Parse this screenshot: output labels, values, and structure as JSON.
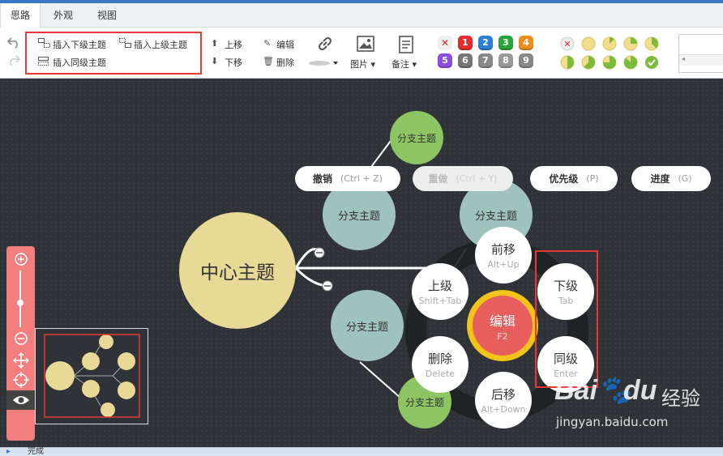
{
  "tabs": [
    {
      "label": "思路",
      "active": true
    },
    {
      "label": "外观",
      "active": false
    },
    {
      "label": "视图",
      "active": false
    }
  ],
  "toolbar": {
    "insert_child": "插入下级主题",
    "insert_parent": "插入上级主题",
    "insert_sibling": "插入同级主题",
    "move_up": "上移",
    "move_down": "下移",
    "edit": "编辑",
    "delete": "删除",
    "image": "图片",
    "note": "备注",
    "priorities": [
      "1",
      "2",
      "3",
      "4",
      "5",
      "6",
      "7",
      "8",
      "9"
    ],
    "priority_colors": [
      "#e52b2b",
      "#2a7fd6",
      "#2aa43a",
      "#f08c1a",
      "#8a4ee0",
      "#777777",
      "#888888",
      "#999999",
      "#888888"
    ]
  },
  "mindmap": {
    "central": "中心主题",
    "branches": [
      "分支主题",
      "分支主题",
      "分支主题",
      "分支主题",
      "分支主题"
    ]
  },
  "context_pills": [
    {
      "label": "撤销",
      "key": "(Ctrl + Z)",
      "disabled": false
    },
    {
      "label": "重做",
      "key": "(Ctrl + Y)",
      "disabled": true
    },
    {
      "label": "优先级",
      "key": "(P)",
      "disabled": false
    },
    {
      "label": "进度",
      "key": "(G)",
      "disabled": false
    }
  ],
  "wheel": {
    "center": {
      "label": "编辑",
      "key": "F2"
    },
    "forward": {
      "label": "前移",
      "key": "Alt+Up"
    },
    "parent": {
      "label": "上级",
      "key": "Shift+Tab"
    },
    "delete": {
      "label": "删除",
      "key": "Delete"
    },
    "backward": {
      "label": "后移",
      "key": "Alt+Down"
    },
    "child": {
      "label": "下级",
      "key": "Tab"
    },
    "sibling": {
      "label": "同级",
      "key": "Enter"
    }
  },
  "status": {
    "text": "完成"
  },
  "watermark": {
    "brand": "Bai",
    "brand2": "du",
    "suffix": "经验",
    "url": "jingyan.baidu.com"
  },
  "colors": {
    "accent": "#3a77c4",
    "central": "#e8d997",
    "branch_teal": "#9fc3bc",
    "branch_green": "#8dc562",
    "highlight": "#e53935",
    "edit_red": "#e85d5d",
    "edit_ring": "#f0c419"
  }
}
